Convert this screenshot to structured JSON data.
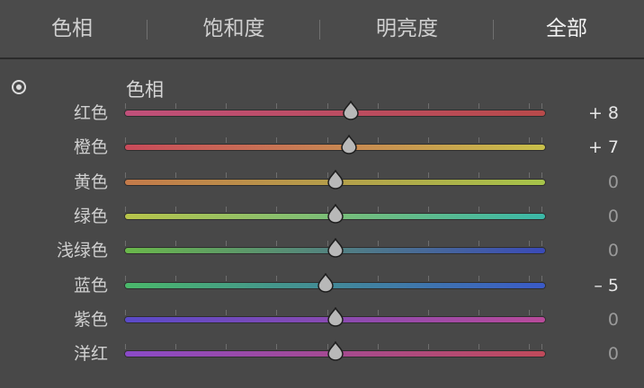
{
  "tabs": [
    {
      "label": "色相",
      "active": false
    },
    {
      "label": "饱和度",
      "active": false
    },
    {
      "label": "明亮度",
      "active": false
    },
    {
      "label": "全部",
      "active": true
    }
  ],
  "section": {
    "title": "色相",
    "icon": "target-adjust-icon"
  },
  "sliders": [
    {
      "label": "红色",
      "value_text": "+ 8",
      "value": 8,
      "gradient": [
        "#c0507a",
        "#b84a4a"
      ]
    },
    {
      "label": "橙色",
      "value_text": "+ 7",
      "value": 7,
      "gradient": [
        "#c94a5a",
        "#c8c04a"
      ]
    },
    {
      "label": "黄色",
      "value_text": "0",
      "value": 0,
      "gradient": [
        "#c47a4a",
        "#a6c44a"
      ]
    },
    {
      "label": "绿色",
      "value_text": "0",
      "value": 0,
      "gradient": [
        "#b8c44a",
        "#3ab8a8"
      ]
    },
    {
      "label": "浅绿色",
      "value_text": "0",
      "value": 0,
      "gradient": [
        "#6ab84a",
        "#3a4ab8"
      ]
    },
    {
      "label": "蓝色",
      "value_text": "– 5",
      "value": -5,
      "gradient": [
        "#4ab86a",
        "#3a5ac8"
      ]
    },
    {
      "label": "紫色",
      "value_text": "0",
      "value": 0,
      "gradient": [
        "#5a4ac8",
        "#b84a9a"
      ]
    },
    {
      "label": "洋红",
      "value_text": "0",
      "value": 0,
      "gradient": [
        "#8a4ac8",
        "#c04a5a"
      ]
    }
  ],
  "slider_range": [
    -100,
    100
  ]
}
